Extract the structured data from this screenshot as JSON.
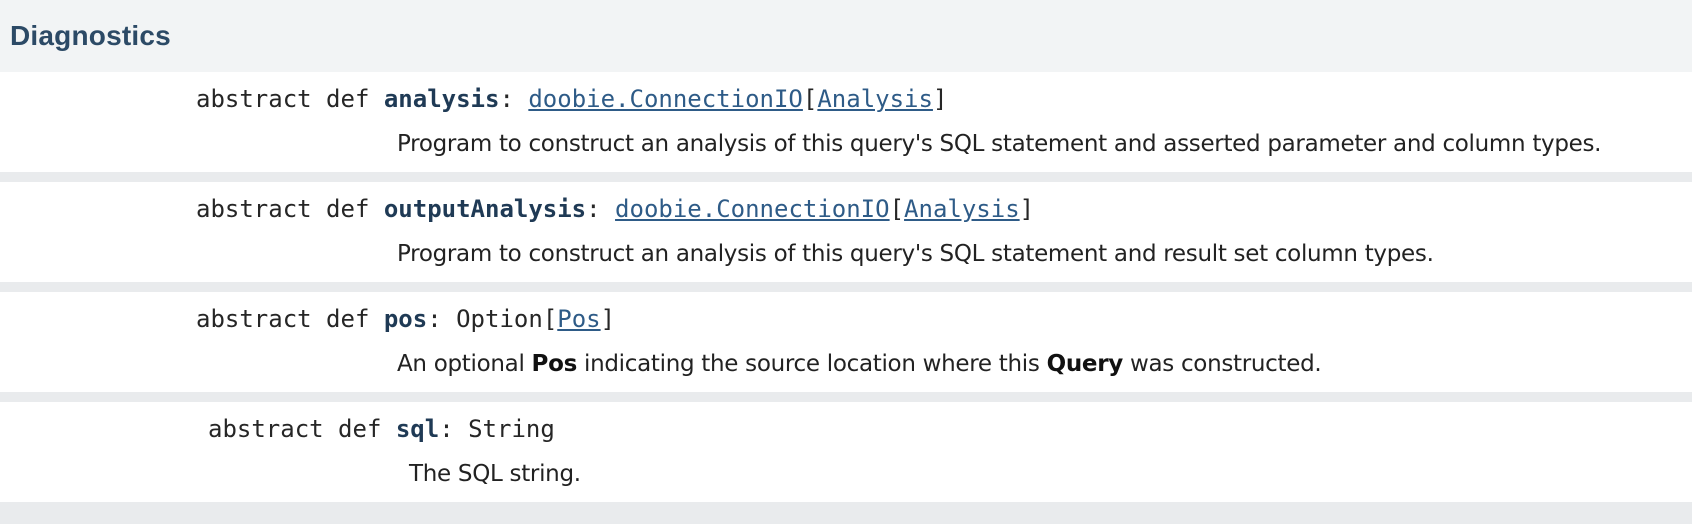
{
  "section": {
    "title": "Diagnostics"
  },
  "members": [
    {
      "modifiers": "abstract def",
      "name": "analysis",
      "colon": ":",
      "result_type": {
        "prefix": "",
        "outer_link": "doobie.ConnectionIO",
        "open": "[",
        "inner_link": "Analysis",
        "close": "]"
      },
      "comment": "Program to construct an analysis of this query's SQL statement and asserted parameter and column types."
    },
    {
      "modifiers": "abstract def",
      "name": "outputAnalysis",
      "colon": ":",
      "result_type": {
        "prefix": "",
        "outer_link": "doobie.ConnectionIO",
        "open": "[",
        "inner_link": "Analysis",
        "close": "]"
      },
      "comment": "Program to construct an analysis of this query's SQL statement and result set column types."
    },
    {
      "modifiers": "abstract def",
      "name": "pos",
      "colon": ":",
      "result_type": {
        "prefix": "Option",
        "outer_link": "",
        "open": "[",
        "inner_link": "Pos",
        "close": "]"
      },
      "comment_parts": [
        "An optional ",
        "Pos",
        " indicating the source location where this ",
        "Query",
        " was constructed."
      ]
    },
    {
      "modifiers": "abstract def",
      "name": "sql",
      "colon": ":",
      "result_type": {
        "prefix": "String"
      },
      "comment": "The SQL string."
    }
  ]
}
